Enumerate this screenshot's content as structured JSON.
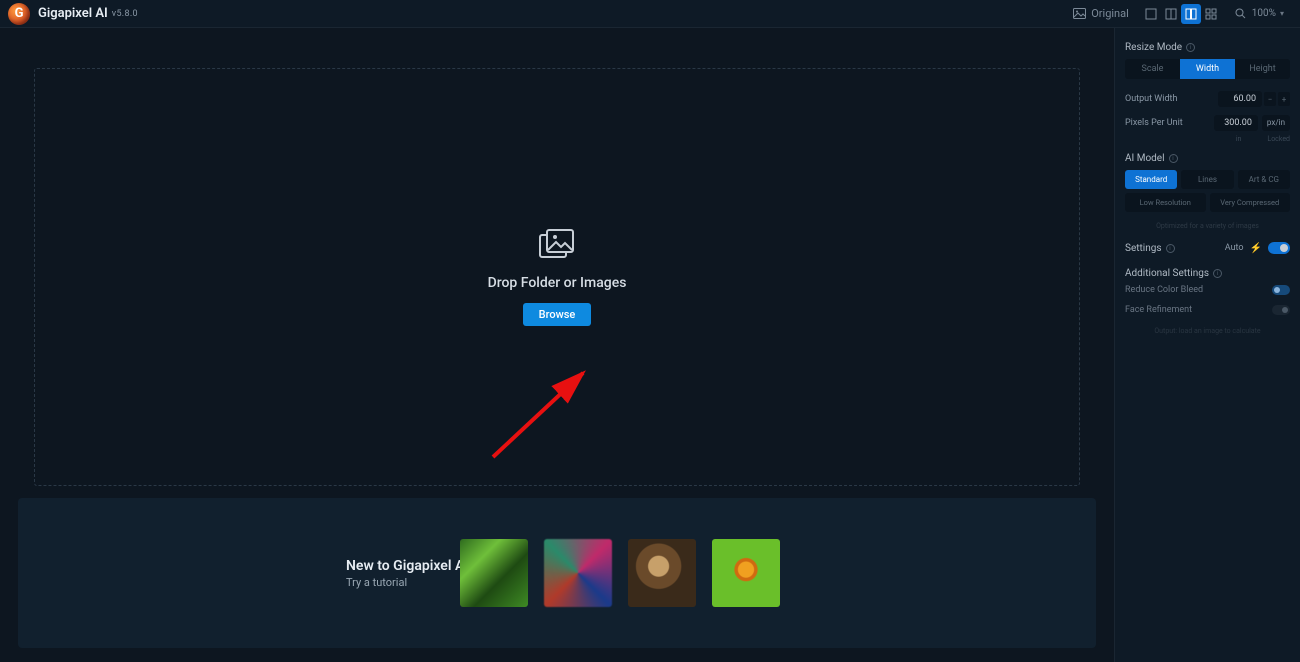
{
  "app": {
    "name": "Gigapixel AI",
    "version": "v5.8.0"
  },
  "topbar": {
    "original_label": "Original",
    "zoom_value": "100%"
  },
  "dropzone": {
    "text": "Drop Folder or Images",
    "browse_label": "Browse"
  },
  "tutorial": {
    "heading": "New to Gigapixel AI?",
    "sub": "Try a tutorial"
  },
  "panel": {
    "resize_mode": {
      "label": "Resize Mode",
      "options": [
        "Scale",
        "Width",
        "Height"
      ],
      "active": 1
    },
    "output_width": {
      "label": "Output Width",
      "value": "60.00"
    },
    "ppu": {
      "label": "Pixels Per Unit",
      "value": "300.00",
      "unit": "px/in"
    },
    "lock_labels": [
      "in",
      "Locked"
    ],
    "ai_model": {
      "label": "AI Model",
      "row1": [
        "Standard",
        "Lines",
        "Art & CG"
      ],
      "row2": [
        "Low Resolution",
        "Very Compressed"
      ],
      "active": 0,
      "note": "Optimized for a variety of images"
    },
    "settings": {
      "label": "Settings",
      "auto_label": "Auto",
      "auto_on": true
    },
    "additional": {
      "label": "Additional Settings"
    },
    "reduce_color": {
      "label": "Reduce Color Bleed",
      "on": false
    },
    "face_refine": {
      "label": "Face Refinement",
      "on": false
    },
    "output_note": "Output: load an image to calculate"
  }
}
